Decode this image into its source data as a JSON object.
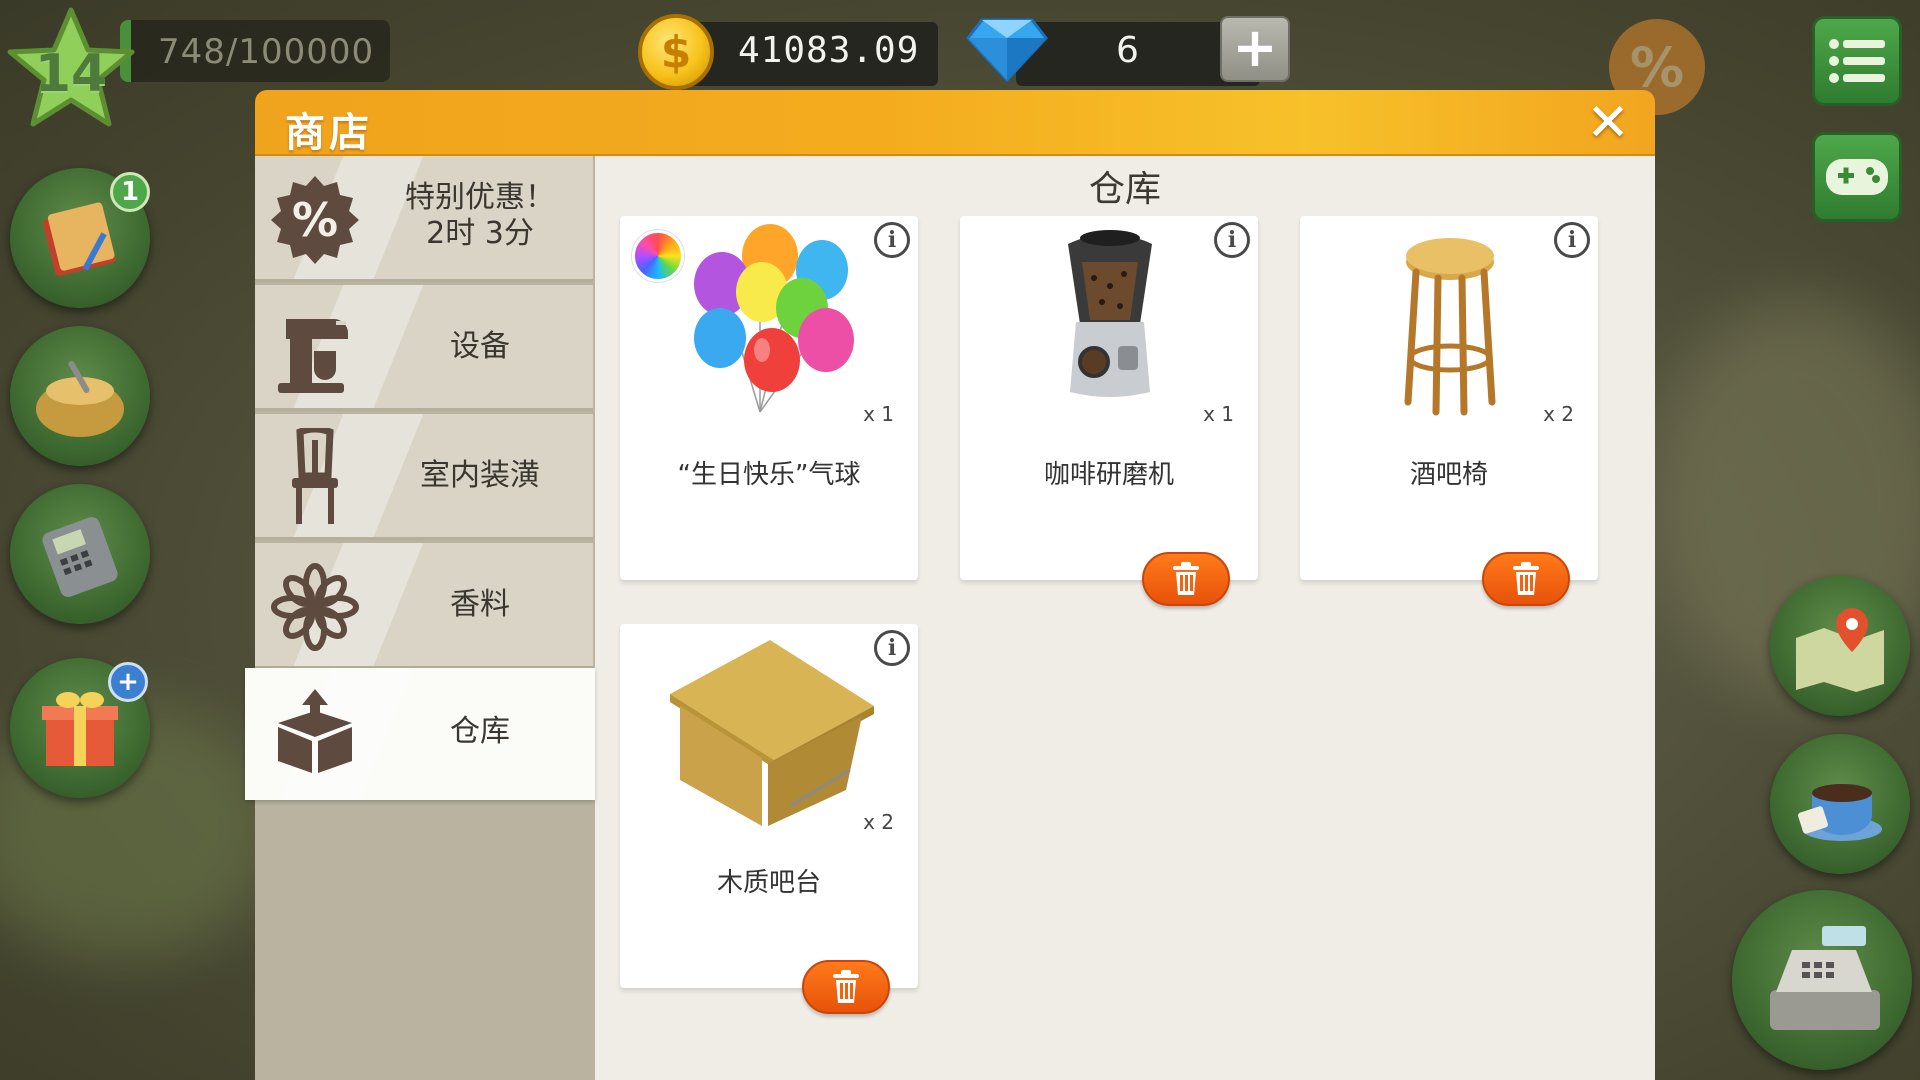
{
  "hud": {
    "level": "14",
    "xp_text": "748/100000",
    "xp_progress": 0.0075,
    "coins": "41083.09",
    "gems": "6",
    "plus_label": "+"
  },
  "side_badges": {
    "recipe_book_count": "1",
    "gift_badge": "+"
  },
  "shop": {
    "title": "商店",
    "close_label": "✕",
    "content_title": "仓库",
    "tabs": [
      {
        "label_line1": "特别优惠！",
        "label_line2": "2时 3分",
        "icon": "percent-icon"
      },
      {
        "label": "设备",
        "icon": "mixer-icon"
      },
      {
        "label": "室内装潢",
        "icon": "chair-icon"
      },
      {
        "label": "香料",
        "icon": "flower-icon"
      },
      {
        "label": "仓库",
        "icon": "box-icon",
        "active": true
      }
    ],
    "items": [
      {
        "name": "“生日快乐”气球",
        "qty": "x 1",
        "icon": "balloons-icon",
        "has_color_option": true,
        "deletable": false
      },
      {
        "name": "咖啡研磨机",
        "qty": "x 1",
        "icon": "coffee-grinder-icon",
        "deletable": true
      },
      {
        "name": "酒吧椅",
        "qty": "x 2",
        "icon": "bar-stool-icon",
        "deletable": true
      },
      {
        "name": "木质吧台",
        "qty": "x 2",
        "icon": "wooden-counter-icon",
        "deletable": true
      }
    ]
  },
  "colors": {
    "header_orange": "#f4ac1e",
    "trash_orange": "#f06410",
    "hud_green": "#4a8f3a"
  }
}
